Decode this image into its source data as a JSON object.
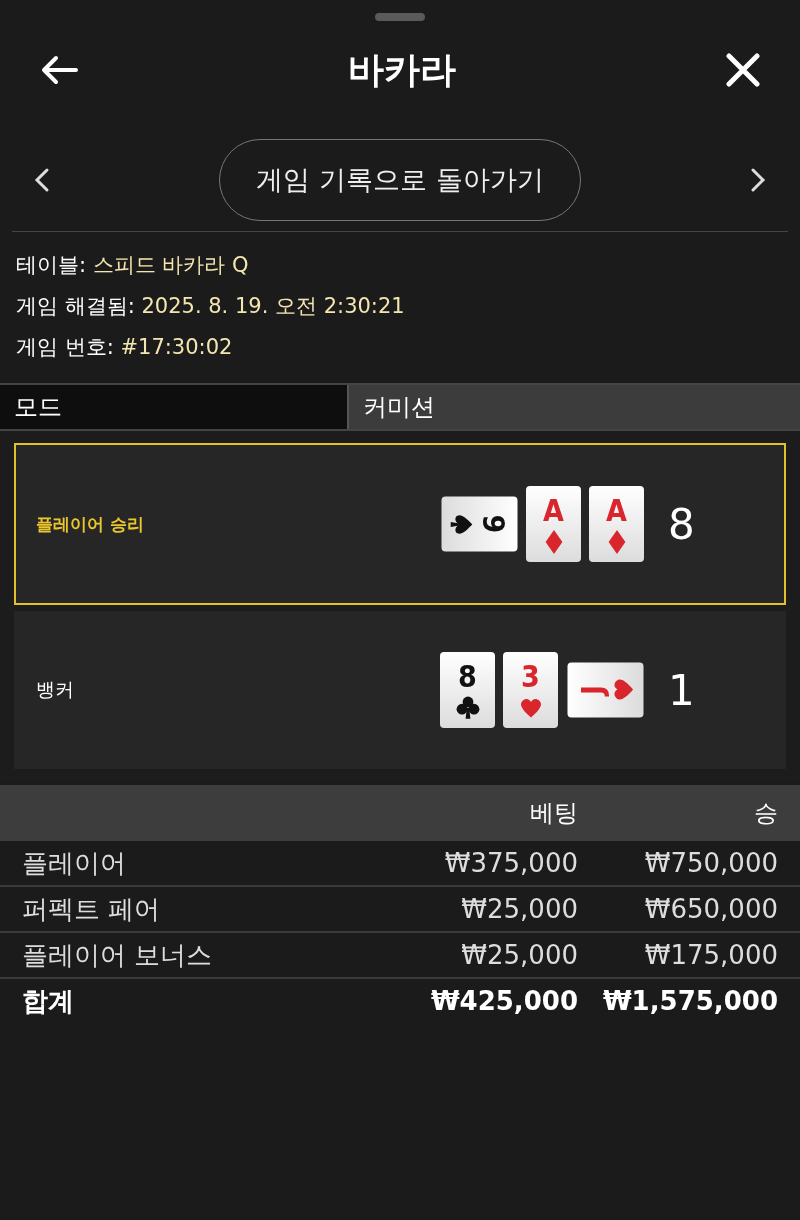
{
  "header": {
    "title": "바카라"
  },
  "nav": {
    "center_button": "게임 기록으로 돌아가기"
  },
  "info": [
    {
      "label": "테이블:",
      "value": "스피드 바카라 Q"
    },
    {
      "label": "게임 해결됨:",
      "value": "2025. 8. 19. 오전 2:30:21"
    },
    {
      "label": "게임 번호:",
      "value": "#17:30:02"
    }
  ],
  "mode_tabs": [
    {
      "label": "모드",
      "selected": true
    },
    {
      "label": "커미션",
      "selected": false
    }
  ],
  "hands": [
    {
      "label": "플레이어 승리",
      "winner": true,
      "score": "8",
      "cards": [
        {
          "rank": "9",
          "kind": "spades",
          "turned_right": true,
          "turned_left": false
        },
        {
          "rank": "A",
          "kind": "diamonds",
          "turned_right": false,
          "turned_left": false
        },
        {
          "rank": "A",
          "kind": "diamonds",
          "turned_right": false,
          "turned_left": false
        }
      ]
    },
    {
      "label": "뱅커",
      "winner": false,
      "score": "1",
      "cards": [
        {
          "rank": "8",
          "kind": "clubs",
          "turned_right": false,
          "turned_left": false
        },
        {
          "rank": "3",
          "kind": "hearts",
          "turned_right": false,
          "turned_left": false
        },
        {
          "rank": "J",
          "kind": "hearts",
          "turned_right": false,
          "turned_left": true
        }
      ]
    }
  ],
  "bets": {
    "columns": [
      "베팅",
      "승"
    ],
    "rows": [
      {
        "kind": "bet",
        "name": "플레이어",
        "bet": "₩375,000",
        "win": "₩750,000"
      },
      {
        "kind": "bet",
        "name": "퍼펙트 페어",
        "bet": "₩25,000",
        "win": "₩650,000"
      },
      {
        "kind": "bet",
        "name": "플레이어 보너스",
        "bet": "₩25,000",
        "win": "₩175,000"
      },
      {
        "kind": "total",
        "name": "합계",
        "bet": "₩425,000",
        "win": "₩1,575,000"
      }
    ]
  }
}
